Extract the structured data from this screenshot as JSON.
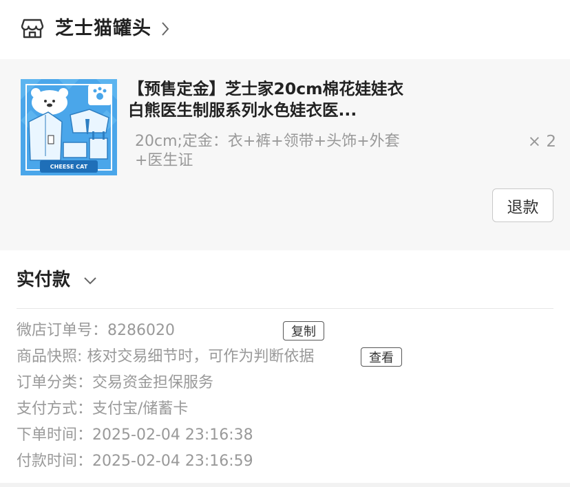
{
  "shop": {
    "name": "芝士猫罐头",
    "icon": "shop-icon"
  },
  "product": {
    "title": "【预售定金】芝士家20cm棉花娃娃衣 白熊医生制服系列水色娃衣医...",
    "spec": "20cm;定金：衣+裤+领带+头饰+外套+医生证",
    "qty": "× 2",
    "thumb_brand": "CHEESE CAT",
    "refund_label": "退款",
    "thumb_color": "#3d9ee6"
  },
  "payment": {
    "label": "实付款"
  },
  "order": {
    "order_no_label": "微店订单号：",
    "order_no_value": "8286020",
    "copy_label": "复制",
    "snapshot_label": "商品快照: ",
    "snapshot_value": "核对交易细节时，可作为判断依据",
    "view_label": "查看",
    "category_label": "订单分类：",
    "category_value": "交易资金担保服务",
    "pay_method_label": "支付方式：",
    "pay_method_value": "支付宝/储蓄卡",
    "order_time_label": "下单时间：",
    "order_time_value": "2025-02-04 23:16:38",
    "pay_time_label": "付款时间：",
    "pay_time_value": "2025-02-04 23:16:59"
  }
}
